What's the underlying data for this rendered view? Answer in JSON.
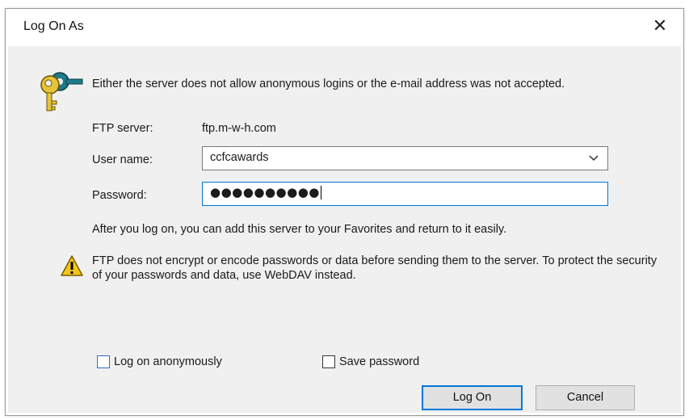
{
  "dialog": {
    "title": "Log On As",
    "close_symbol": "✕",
    "message": "Either the server does not allow anonymous logins or the e-mail address was not accepted.",
    "ftp_server_label": "FTP server:",
    "ftp_server_value": "ftp.m-w-h.com",
    "username_label": "User name:",
    "username_value": "ccfcawards",
    "password_label": "Password:",
    "password_mask": "●●●●●●●●●●",
    "info_text": "After you log on, you can add this server to your Favorites and return to it easily.",
    "warning_text": "FTP does not encrypt or encode passwords or data before sending them to the server.  To protect the security of your passwords and data, use WebDAV instead.",
    "anonymous_label": "Log on anonymously",
    "save_password_label": "Save password",
    "logon_button": "Log On",
    "cancel_button": "Cancel"
  },
  "icons": {
    "header": "keys-icon",
    "warning": "warning-icon",
    "dropdown": "chevron-down-icon",
    "close": "close-icon"
  },
  "colors": {
    "accent": "#0078d7",
    "client_bg": "#f0f0f0",
    "button_bg": "#e1e1e1",
    "key_yellow": "#e6c43a",
    "key_teal": "#1f7a8a"
  }
}
